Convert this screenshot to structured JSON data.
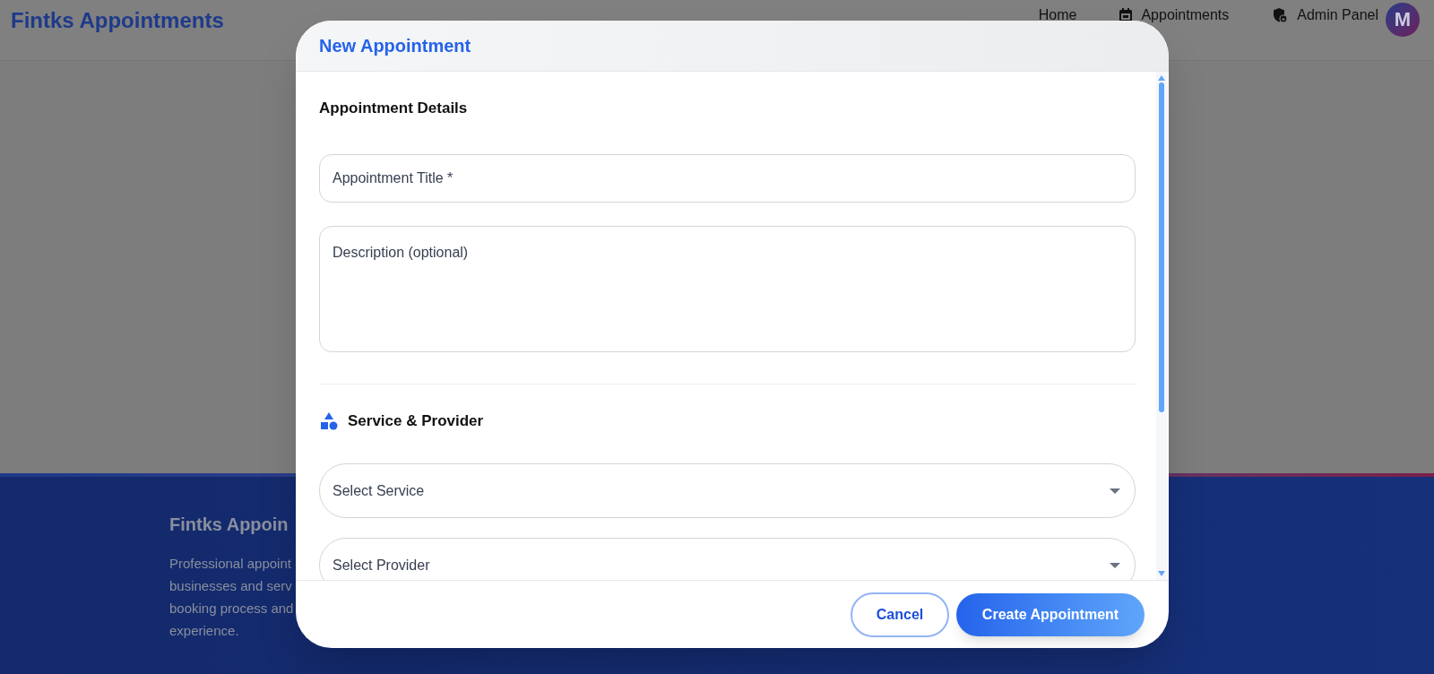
{
  "nav": {
    "brand": "Fintks Appointments",
    "links": [
      {
        "label": "Home"
      },
      {
        "label": "Appointments"
      },
      {
        "label": "Admin Panel"
      }
    ],
    "avatar": "M"
  },
  "footer": {
    "title": "Fintks Appoin",
    "lines": [
      "Professional appoint",
      "businesses and serv",
      "booking process and",
      "experience."
    ]
  },
  "modal": {
    "title": "New Appointment",
    "sections": [
      {
        "heading": "Appointment Details",
        "icon": false,
        "fields": [
          {
            "kind": "text",
            "placeholder": "Appointment Title *"
          },
          {
            "kind": "textarea",
            "placeholder": "Description (optional)"
          }
        ]
      },
      {
        "heading": "Service & Provider",
        "icon": true,
        "fields": [
          {
            "kind": "select",
            "placeholder": "Select Service"
          },
          {
            "kind": "select",
            "placeholder": "Select Provider"
          }
        ]
      }
    ],
    "buttons": [
      {
        "kind": "outline",
        "label": "Cancel"
      },
      {
        "kind": "primary",
        "label": "Create Appointment"
      }
    ]
  }
}
